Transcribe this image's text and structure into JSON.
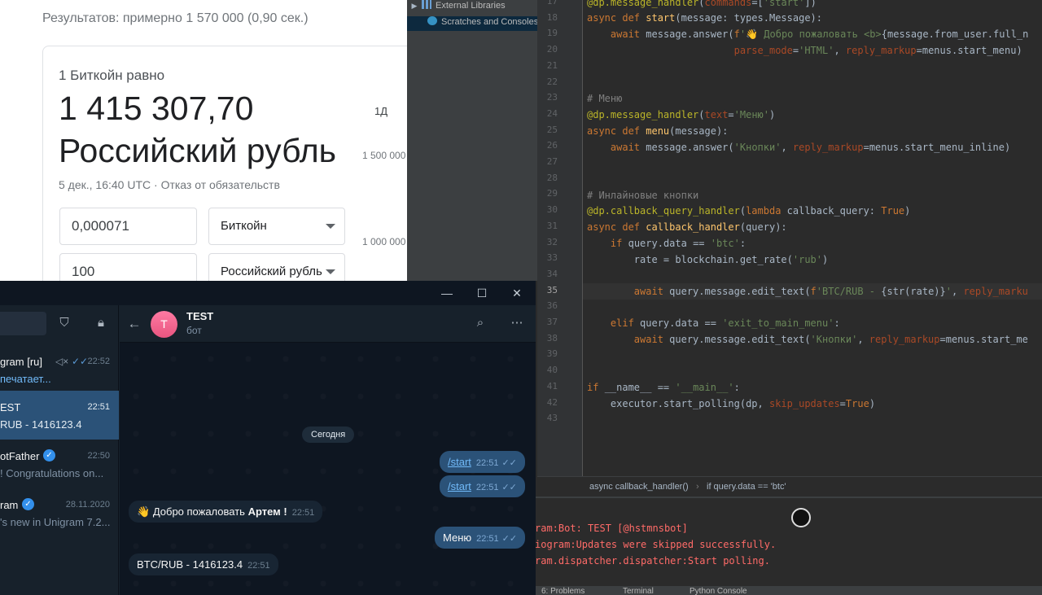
{
  "browser": {
    "results": "Результатов: примерно 1 570 000 (0,90 сек.)",
    "equals": "1 Биткойн равно",
    "value": "1 415 307,70",
    "currency": "Российский рубль",
    "meta": "5 дек., 16:40 UTC · Отказ от обязательств",
    "input_top": "0,000071",
    "input_bottom": "100",
    "select_top": "Биткойн",
    "select_bottom": "Российский рубль",
    "period": "1Д",
    "axis_top": "1 500 000",
    "axis_bottom": "1 000 000"
  },
  "ide": {
    "tree": [
      {
        "label": "External Libraries",
        "icon": "library-icon"
      },
      {
        "label": "Scratches and Consoles",
        "icon": "scratch-icon"
      }
    ],
    "line_numbers": [
      "17",
      "18",
      "19",
      "20",
      "21",
      "22",
      "23",
      "24",
      "25",
      "26",
      "27",
      "28",
      "29",
      "30",
      "31",
      "32",
      "33",
      "34",
      "35",
      "36",
      "37",
      "38",
      "39",
      "40",
      "41",
      "42",
      "43"
    ],
    "current_line": "35",
    "breadcrumb": [
      "async callback_handler()",
      "if query.data == 'btc'"
    ],
    "console": [
      "ram:Bot: TEST [@hstmnsbot]",
      "iogram:Updates were skipped successfully.",
      "ram.dispatcher.dispatcher:Start polling."
    ],
    "status_tabs": [
      "6: Problems",
      "Terminal",
      "Python Console"
    ]
  },
  "telegram": {
    "chats": [
      {
        "name": "gram [ru]",
        "preview": "печатает...",
        "time": "22:52"
      },
      {
        "name": "EST",
        "preview": "RUB - 1416123.4",
        "time": "22:51"
      },
      {
        "name": "otFather",
        "preview": "! Congratulations on...",
        "time": "22:50"
      },
      {
        "name": "ram",
        "preview": "'s new in Unigram 7.2...",
        "time": "28.11.2020"
      }
    ],
    "chat_title": "TEST",
    "chat_subtitle": "бот",
    "avatar_letter": "T",
    "date_chip": "Сегодня",
    "messages": [
      {
        "text": "/start",
        "time": "22:51",
        "dir": "out"
      },
      {
        "text": "/start",
        "time": "22:51",
        "dir": "out"
      },
      {
        "text": "Добро пожаловать",
        "bold": "Артем !",
        "time": "22:51",
        "dir": "in"
      },
      {
        "text": "Меню",
        "time": "22:51",
        "dir": "out"
      },
      {
        "text": "BTC/RUB - 1416123.4",
        "time": "22:51",
        "dir": "in"
      }
    ]
  },
  "colors": {
    "tg_bg": "#0e1621",
    "tg_active": "#2b5278",
    "ide_bg": "#2b2b2b",
    "console_error": "#ff6b68"
  }
}
